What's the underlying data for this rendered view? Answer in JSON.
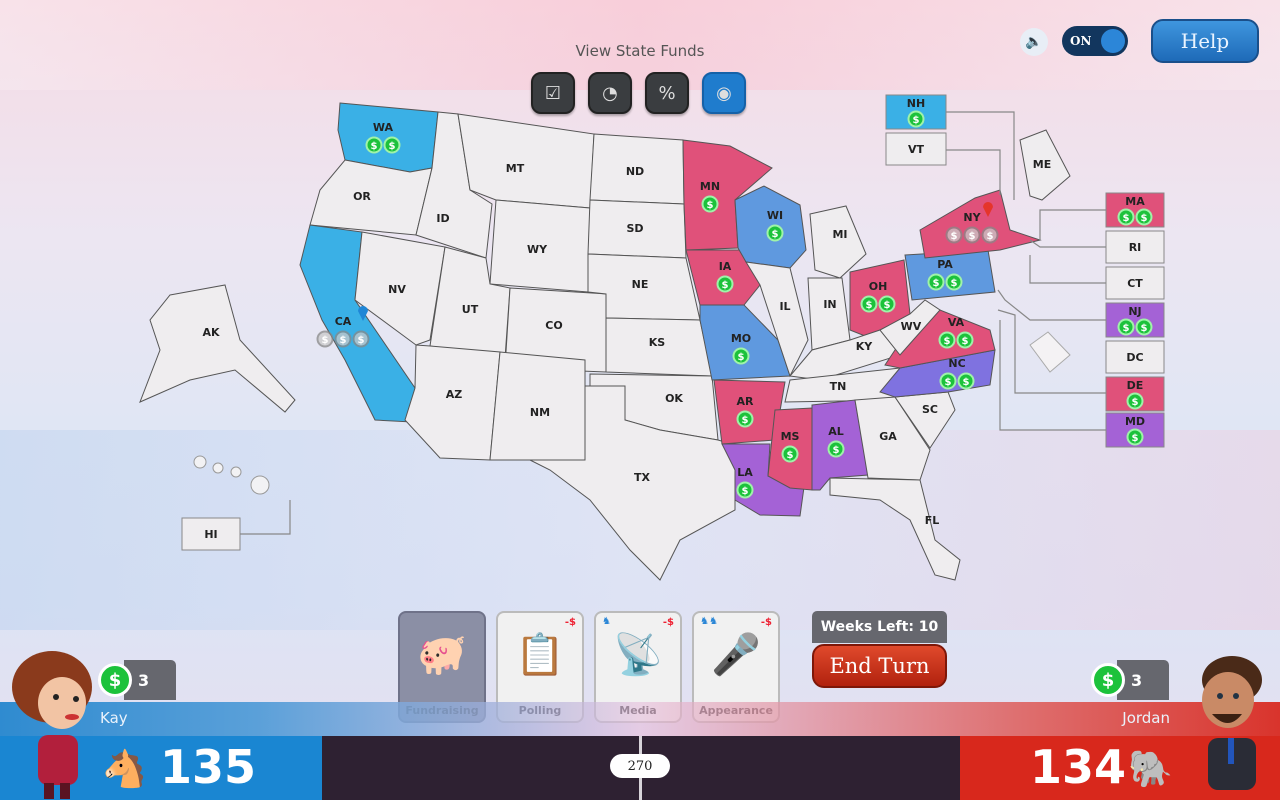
{
  "header": {
    "view_title": "View State Funds",
    "view_buttons": [
      {
        "name": "checkbox-view",
        "glyph": "☑",
        "active": false
      },
      {
        "name": "gauge-view",
        "glyph": "◔",
        "active": false
      },
      {
        "name": "dr-ratio-view",
        "glyph": "%",
        "active": false
      },
      {
        "name": "funds-view",
        "glyph": "◉",
        "active": true
      }
    ],
    "sound_toggle": "ON",
    "help_label": "Help"
  },
  "colors": {
    "dem_blue": "#3ab0e6",
    "rep_red": "#e0517a",
    "lean_dem": "#5f99df",
    "tossup_purple": "#a462d6",
    "lean_nc": "#7f72e0",
    "neutral": "#efedef",
    "coin_green": "#1cc23b"
  },
  "states": [
    {
      "abbr": "WA",
      "color": "dem_blue",
      "coins": 2
    },
    {
      "abbr": "OR",
      "color": "neutral",
      "coins": 0
    },
    {
      "abbr": "CA",
      "color": "dem_blue",
      "coins": 3,
      "coins_faded": true,
      "pin": "blue"
    },
    {
      "abbr": "NV",
      "color": "neutral",
      "coins": 0
    },
    {
      "abbr": "ID",
      "color": "neutral",
      "coins": 0
    },
    {
      "abbr": "MT",
      "color": "neutral",
      "coins": 0
    },
    {
      "abbr": "WY",
      "color": "neutral",
      "coins": 0
    },
    {
      "abbr": "UT",
      "color": "neutral",
      "coins": 0
    },
    {
      "abbr": "AZ",
      "color": "neutral",
      "coins": 0
    },
    {
      "abbr": "CO",
      "color": "neutral",
      "coins": 0
    },
    {
      "abbr": "NM",
      "color": "neutral",
      "coins": 0
    },
    {
      "abbr": "ND",
      "color": "neutral",
      "coins": 0
    },
    {
      "abbr": "SD",
      "color": "neutral",
      "coins": 0
    },
    {
      "abbr": "NE",
      "color": "neutral",
      "coins": 0
    },
    {
      "abbr": "KS",
      "color": "neutral",
      "coins": 0
    },
    {
      "abbr": "OK",
      "color": "neutral",
      "coins": 0
    },
    {
      "abbr": "TX",
      "color": "neutral",
      "coins": 0
    },
    {
      "abbr": "MN",
      "color": "rep_red",
      "coins": 1
    },
    {
      "abbr": "IA",
      "color": "rep_red",
      "coins": 1
    },
    {
      "abbr": "MO",
      "color": "lean_dem",
      "coins": 1
    },
    {
      "abbr": "AR",
      "color": "rep_red",
      "coins": 1
    },
    {
      "abbr": "LA",
      "color": "tossup_purple",
      "coins": 1
    },
    {
      "abbr": "WI",
      "color": "lean_dem",
      "coins": 1
    },
    {
      "abbr": "IL",
      "color": "neutral",
      "coins": 0
    },
    {
      "abbr": "MI",
      "color": "neutral",
      "coins": 0
    },
    {
      "abbr": "IN",
      "color": "neutral",
      "coins": 0
    },
    {
      "abbr": "OH",
      "color": "rep_red",
      "coins": 2
    },
    {
      "abbr": "KY",
      "color": "neutral",
      "coins": 0
    },
    {
      "abbr": "TN",
      "color": "neutral",
      "coins": 0
    },
    {
      "abbr": "MS",
      "color": "rep_red",
      "coins": 1
    },
    {
      "abbr": "AL",
      "color": "tossup_purple",
      "coins": 1
    },
    {
      "abbr": "GA",
      "color": "neutral",
      "coins": 0
    },
    {
      "abbr": "FL",
      "color": "neutral",
      "coins": 0
    },
    {
      "abbr": "SC",
      "color": "neutral",
      "coins": 0
    },
    {
      "abbr": "NC",
      "color": "lean_nc",
      "coins": 2
    },
    {
      "abbr": "VA",
      "color": "rep_red",
      "coins": 2
    },
    {
      "abbr": "WV",
      "color": "neutral",
      "coins": 0
    },
    {
      "abbr": "PA",
      "color": "lean_dem",
      "coins": 2
    },
    {
      "abbr": "NY",
      "color": "rep_red",
      "coins": 3,
      "coins_faded": true,
      "pin": "red"
    },
    {
      "abbr": "ME",
      "color": "neutral",
      "coins": 0
    },
    {
      "abbr": "AK",
      "color": "neutral",
      "coins": 0
    }
  ],
  "small_states": [
    {
      "abbr": "NH",
      "color": "dem_blue",
      "coins": 1
    },
    {
      "abbr": "VT",
      "color": "neutral",
      "coins": 0
    },
    {
      "abbr": "MA",
      "color": "rep_red",
      "coins": 2
    },
    {
      "abbr": "RI",
      "color": "neutral",
      "coins": 0
    },
    {
      "abbr": "CT",
      "color": "neutral",
      "coins": 0
    },
    {
      "abbr": "NJ",
      "color": "tossup_purple",
      "coins": 2
    },
    {
      "abbr": "DC",
      "color": "neutral",
      "coins": 0
    },
    {
      "abbr": "DE",
      "color": "rep_red",
      "coins": 1
    },
    {
      "abbr": "MD",
      "color": "tossup_purple",
      "coins": 1
    },
    {
      "abbr": "HI",
      "color": "neutral",
      "coins": 0
    }
  ],
  "actions": [
    {
      "label": "Fundraising",
      "icon": "piggy-bank",
      "active": true,
      "cost": "",
      "party": ""
    },
    {
      "label": "Polling",
      "icon": "clipboard",
      "active": false,
      "cost": "-$",
      "party": ""
    },
    {
      "label": "Media",
      "icon": "satellite-dish",
      "active": false,
      "cost": "-$",
      "party": "♞"
    },
    {
      "label": "Appearance",
      "icon": "podium",
      "active": false,
      "cost": "-$",
      "party": "♞♞"
    }
  ],
  "turn": {
    "weeks_left": "Weeks Left: 10",
    "end_turn_label": "End Turn"
  },
  "players": {
    "left": {
      "name": "Kay",
      "funds": "3",
      "electoral_votes": "135",
      "party_icon": "donkey"
    },
    "right": {
      "name": "Jordan",
      "funds": "3",
      "electoral_votes": "134",
      "party_icon": "elephant"
    }
  },
  "goal": "270"
}
